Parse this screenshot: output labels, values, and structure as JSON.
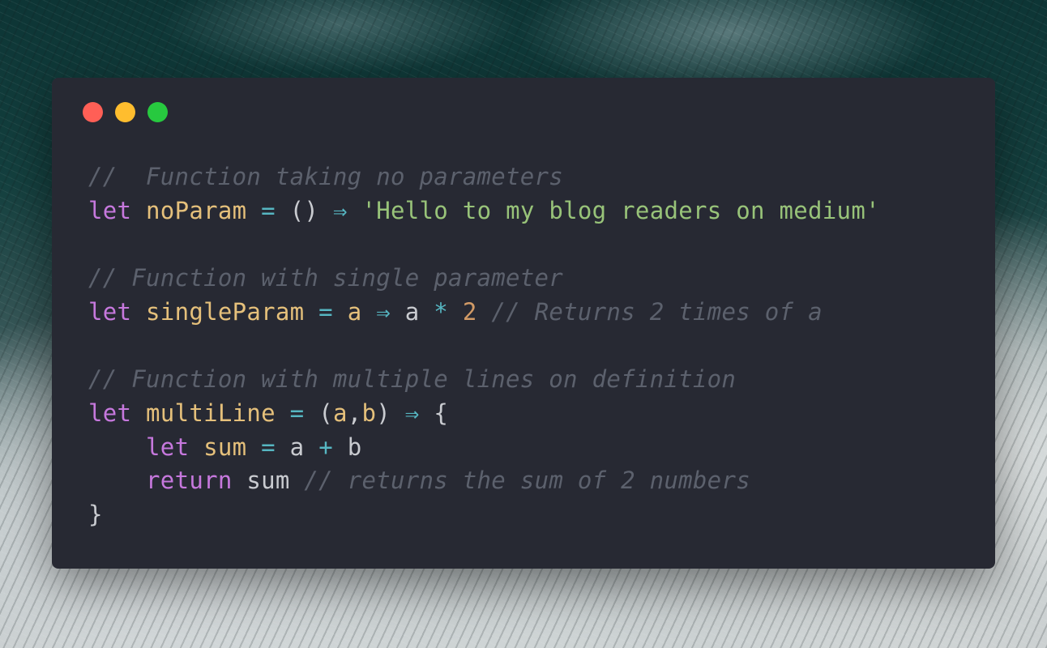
{
  "colors": {
    "dot_close": "#ff5f56",
    "dot_minimize": "#ffbd2e",
    "dot_zoom": "#27c93f",
    "window_bg": "#272933",
    "keyword": "#c678dd",
    "definition": "#e5c07b",
    "operator": "#56b6c2",
    "string": "#98c379",
    "number": "#d19a66",
    "comment": "#5c616d",
    "plain": "#c9cbd0"
  },
  "code": {
    "line1": {
      "comment": "//  Function taking no parameters"
    },
    "line2": {
      "kw": "let",
      "name": "noParam",
      "eq": "=",
      "parens": "()",
      "arrow": "⇒",
      "str": "'Hello to my blog readers on medium'"
    },
    "line4": {
      "comment": "// Function with single parameter"
    },
    "line5": {
      "kw": "let",
      "name": "singleParam",
      "eq": "=",
      "param": "a",
      "arrow": "⇒",
      "a": "a",
      "mul": "*",
      "num": "2",
      "comment": "// Returns 2 times of a"
    },
    "line7": {
      "comment": "// Function with multiple lines on definition"
    },
    "line8": {
      "kw": "let",
      "name": "multiLine",
      "eq": "=",
      "p_open": "(",
      "a": "a",
      "comma": ",",
      "b": "b",
      "p_close": ")",
      "arrow": "⇒",
      "brace": "{"
    },
    "line9": {
      "indent": "    ",
      "kw": "let",
      "name": "sum",
      "eq": "=",
      "a": "a",
      "plus": "+",
      "b": "b"
    },
    "line10": {
      "indent": "    ",
      "kw": "return",
      "sum": "sum",
      "comment": "// returns the sum of 2 numbers"
    },
    "line11": {
      "brace": "}"
    }
  }
}
